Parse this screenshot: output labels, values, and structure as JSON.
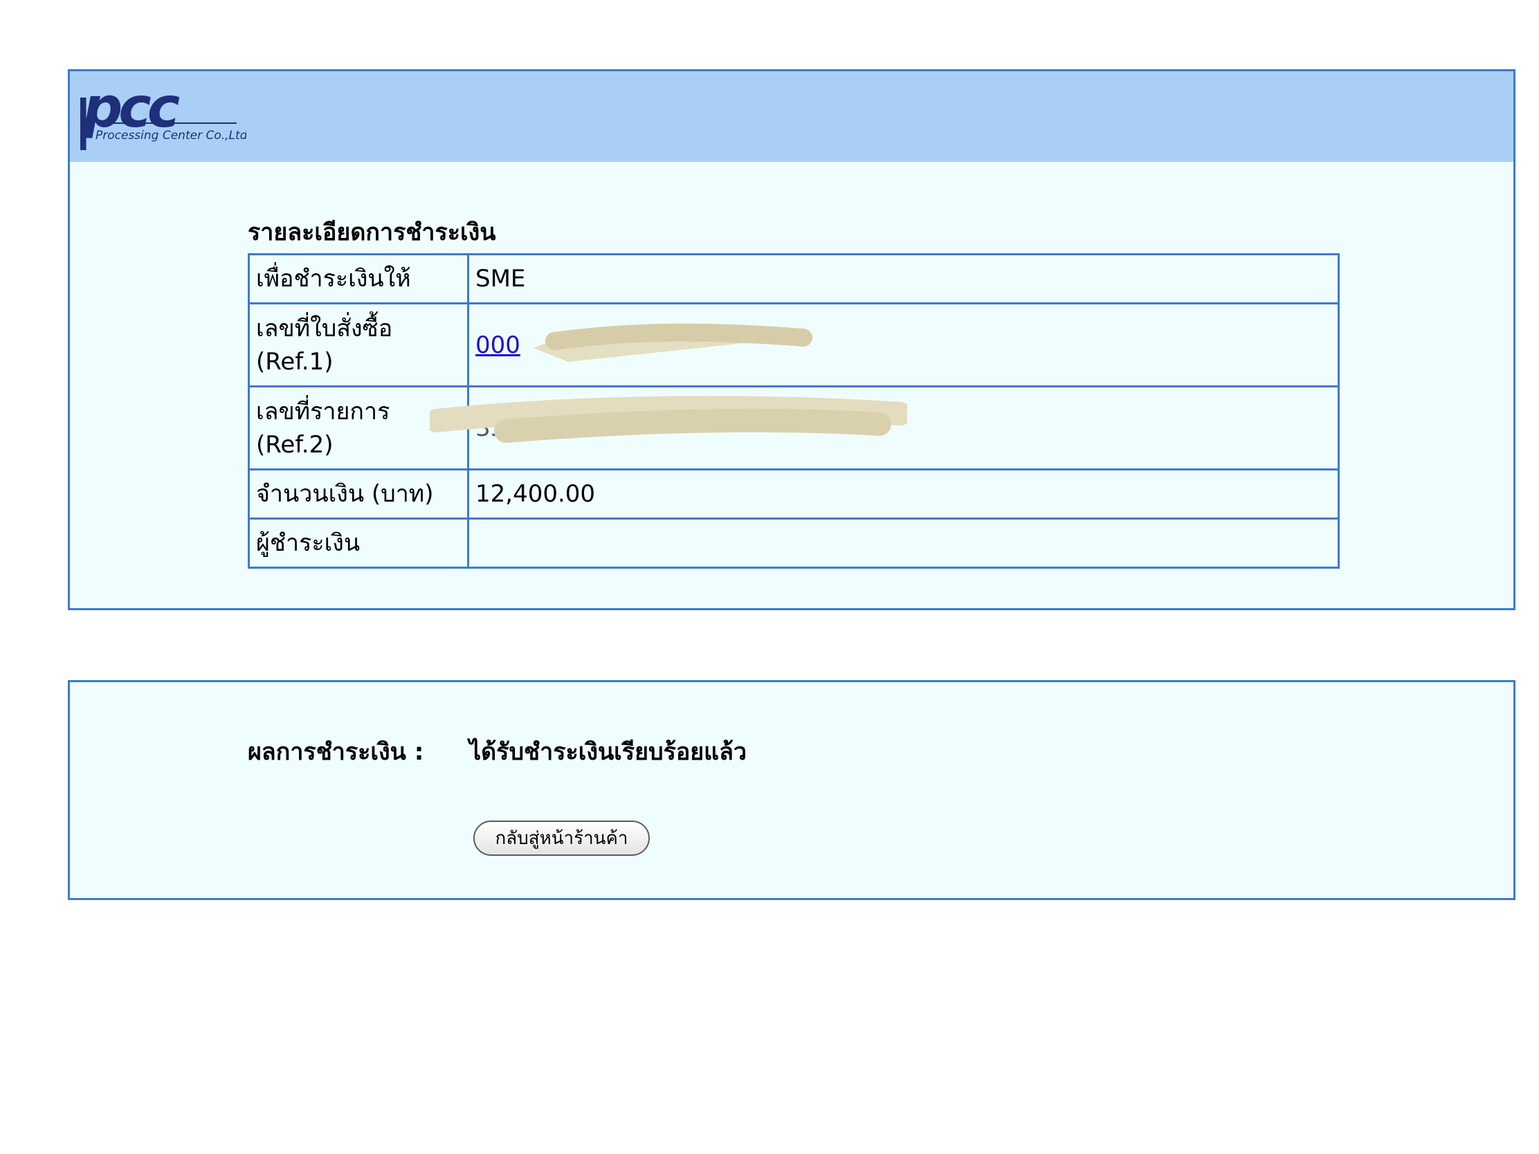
{
  "header": {
    "logo_text": "pcc",
    "logo_subtext": "Processing Center Co.,Ltd."
  },
  "details": {
    "title": "รายละเอียดการชำระเงิน",
    "rows": [
      {
        "label": "เพื่อชำระเงินให้",
        "value": "SME"
      },
      {
        "label_line1": "เลขที่ใบสั่งซื้อ",
        "label_line2": "(Ref.1)",
        "value": "000"
      },
      {
        "label_line1": "เลขที่รายการ",
        "label_line2": "(Ref.2)",
        "value": "351"
      },
      {
        "label": "จำนวนเงิน (บาท)",
        "value": "12,400.00"
      },
      {
        "label": "ผู้ชำระเงิน",
        "value": ""
      }
    ]
  },
  "result": {
    "label": "ผลการชำระเงิน :",
    "value": "ได้รับชำระเงินเรียบร้อยแล้ว",
    "back_button_label": "กลับสู่หน้าร้านค้า"
  },
  "colors": {
    "border": "#3b7ccb",
    "header_band": "#a9cff4",
    "panel_bg": "#f0fdfe",
    "link": "#1a0dcc",
    "logo": "#1f2f7a"
  }
}
